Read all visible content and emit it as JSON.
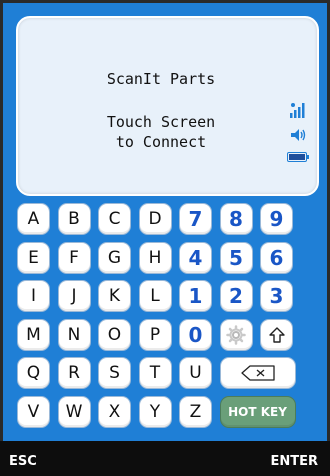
{
  "screen": {
    "title": "ScanIt Parts",
    "message_line1": "Touch Screen",
    "message_line2": "to Connect",
    "icons": [
      "signal-icon",
      "speaker-icon",
      "battery-icon"
    ]
  },
  "keyboard": {
    "rows": [
      [
        "A",
        "B",
        "C",
        "D",
        "7",
        "8",
        "9"
      ],
      [
        "E",
        "F",
        "G",
        "H",
        "4",
        "5",
        "6"
      ],
      [
        "I",
        "J",
        "K",
        "L",
        "1",
        "2",
        "3"
      ],
      [
        "M",
        "N",
        "O",
        "P",
        "0",
        "settings-icon",
        "shift-icon"
      ],
      [
        "Q",
        "R",
        "S",
        "T",
        "U",
        "backspace-icon"
      ],
      [
        "V",
        "W",
        "X",
        "Y",
        "Z",
        "HOT KEY"
      ]
    ],
    "hot_key_label": "HOT KEY"
  },
  "bottom": {
    "esc_label": "ESC",
    "enter_label": "ENTER"
  },
  "colors": {
    "device_blue": "#1f7fd6",
    "number_blue": "#1a56c6",
    "hotkey_green": "#6a9f79"
  }
}
